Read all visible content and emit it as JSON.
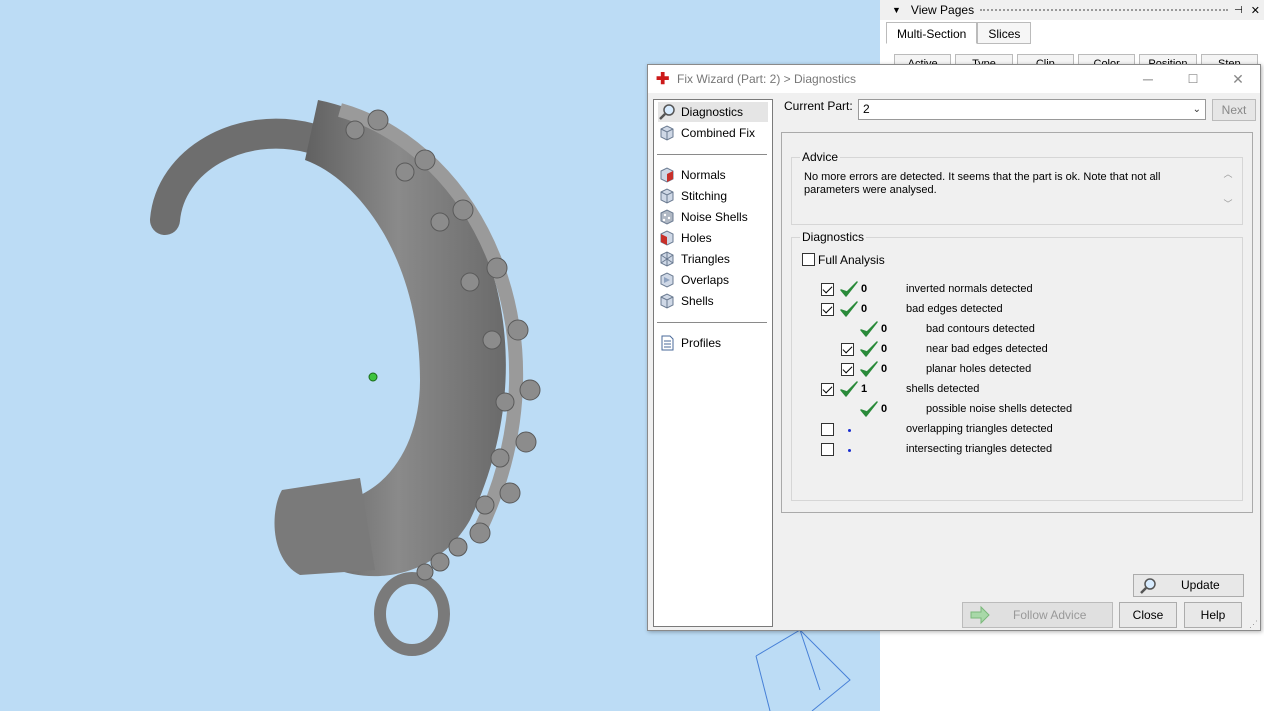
{
  "view_pages": {
    "title": "View Pages",
    "tabs": [
      "Multi-Section",
      "Slices"
    ],
    "columns": [
      "Active",
      "Type",
      "Clip",
      "Color",
      "Position",
      "Step"
    ]
  },
  "dialog": {
    "title": "Fix Wizard (Part: 2) > Diagnostics",
    "nav": {
      "group1": [
        {
          "label": "Diagnostics",
          "icon": "magnifier-icon",
          "selected": true
        },
        {
          "label": "Combined Fix",
          "icon": "cube-fix-icon"
        }
      ],
      "group2": [
        {
          "label": "Normals",
          "icon": "normals-cube-icon"
        },
        {
          "label": "Stitching",
          "icon": "stitching-cube-icon"
        },
        {
          "label": "Noise Shells",
          "icon": "noise-shells-icon"
        },
        {
          "label": "Holes",
          "icon": "holes-cube-icon"
        },
        {
          "label": "Triangles",
          "icon": "triangles-cube-icon"
        },
        {
          "label": "Overlaps",
          "icon": "overlaps-cube-icon"
        },
        {
          "label": "Shells",
          "icon": "shells-cube-icon"
        }
      ],
      "group3": [
        {
          "label": "Profiles",
          "icon": "document-icon"
        }
      ]
    },
    "current_part_label": "Current Part:",
    "current_part_value": "2",
    "next_label": "Next",
    "advice": {
      "title": "Advice",
      "text": "No more errors are detected. It seems that the part is ok. Note that not all parameters were analysed."
    },
    "diagnostics": {
      "title": "Diagnostics",
      "full_analysis_label": "Full Analysis",
      "full_analysis_checked": false,
      "rows": [
        {
          "checkbox": true,
          "checked": true,
          "status": "ok",
          "count": "0",
          "label": "inverted normals detected",
          "indent": 0
        },
        {
          "checkbox": true,
          "checked": true,
          "status": "ok",
          "count": "0",
          "label": "bad edges detected",
          "indent": 0
        },
        {
          "checkbox": false,
          "checked": false,
          "status": "ok",
          "count": "0",
          "label": "bad contours detected",
          "indent": 1
        },
        {
          "checkbox": true,
          "checked": true,
          "status": "ok",
          "count": "0",
          "label": "near bad edges detected",
          "indent": 1
        },
        {
          "checkbox": true,
          "checked": true,
          "status": "ok",
          "count": "0",
          "label": "planar holes detected",
          "indent": 1
        },
        {
          "checkbox": true,
          "checked": true,
          "status": "ok",
          "count": "1",
          "label": "shells detected",
          "indent": 0
        },
        {
          "checkbox": false,
          "checked": false,
          "status": "ok",
          "count": "0",
          "label": "possible noise shells detected",
          "indent": 1
        },
        {
          "checkbox": true,
          "checked": false,
          "status": "pending",
          "count": "",
          "label": "overlapping triangles detected",
          "indent": 0
        },
        {
          "checkbox": true,
          "checked": false,
          "status": "pending",
          "count": "",
          "label": "intersecting triangles detected",
          "indent": 0
        }
      ],
      "update_label": "Update"
    },
    "follow_advice_label": "Follow Advice",
    "close_label": "Close",
    "help_label": "Help"
  },
  "colors": {
    "viewport_bg": "#bcdcf5",
    "check_green": "#2a8a3a",
    "pending_dot": "#1a2ed0"
  }
}
